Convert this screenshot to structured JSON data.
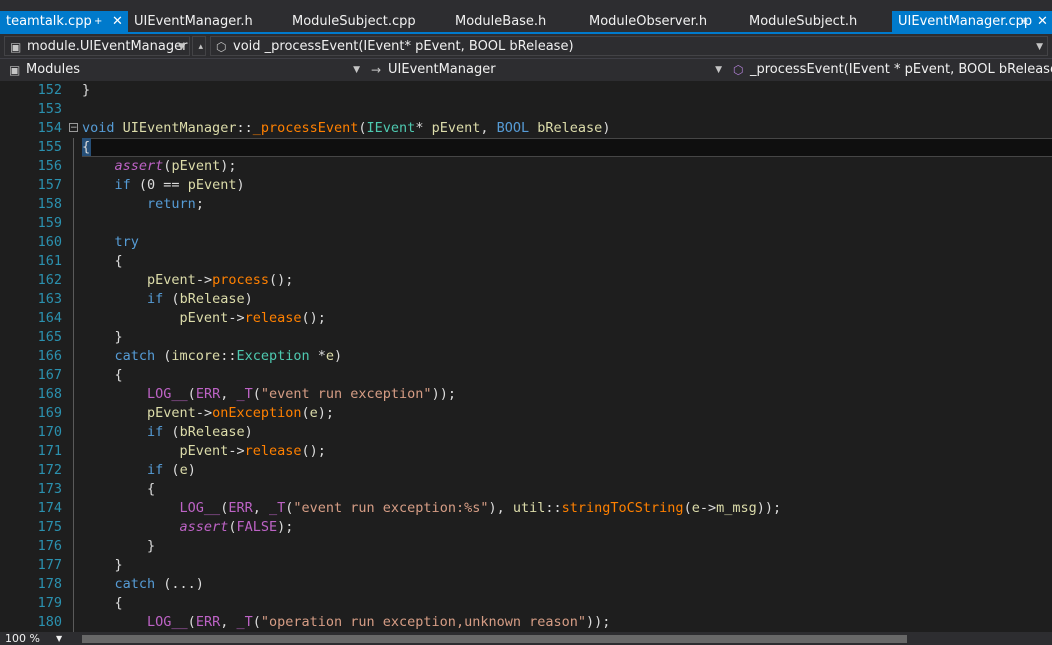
{
  "tabs": [
    {
      "label": "teamtalk.cpp",
      "active": true,
      "pinned": true,
      "closable": true
    },
    {
      "label": "UIEventManager.h"
    },
    {
      "label": "ModuleSubject.cpp"
    },
    {
      "label": "ModuleBase.h"
    },
    {
      "label": "ModuleObserver.h"
    },
    {
      "label": "ModuleSubject.h"
    },
    {
      "label": "UIEventManager.cpp",
      "active": true,
      "pinned": true,
      "closable": true
    }
  ],
  "nav1": {
    "scope": "module.UIEventManager",
    "member": "void _processEvent(IEvent* pEvent, BOOL bRelease)"
  },
  "nav2": {
    "project": "Modules",
    "class": "UIEventManager",
    "function": "_processEvent(IEvent * pEvent, BOOL bRelease)"
  },
  "code_lines": [
    {
      "n": "152",
      "text": "}"
    },
    {
      "n": "153",
      "text": ""
    },
    {
      "n": "154",
      "text": "void UIEventManager::_processEvent(IEvent* pEvent, BOOL bRelease)"
    },
    {
      "n": "155",
      "text": "{"
    },
    {
      "n": "156",
      "text": "    assert(pEvent);"
    },
    {
      "n": "157",
      "text": "    if (0 == pEvent)"
    },
    {
      "n": "158",
      "text": "        return;"
    },
    {
      "n": "159",
      "text": ""
    },
    {
      "n": "160",
      "text": "    try"
    },
    {
      "n": "161",
      "text": "    {"
    },
    {
      "n": "162",
      "text": "        pEvent->process();"
    },
    {
      "n": "163",
      "text": "        if (bRelease)"
    },
    {
      "n": "164",
      "text": "            pEvent->release();"
    },
    {
      "n": "165",
      "text": "    }"
    },
    {
      "n": "166",
      "text": "    catch (imcore::Exception *e)"
    },
    {
      "n": "167",
      "text": "    {"
    },
    {
      "n": "168",
      "text": "        LOG__(ERR, _T(\"event run exception\"));"
    },
    {
      "n": "169",
      "text": "        pEvent->onException(e);"
    },
    {
      "n": "170",
      "text": "        if (bRelease)"
    },
    {
      "n": "171",
      "text": "            pEvent->release();"
    },
    {
      "n": "172",
      "text": "        if (e)"
    },
    {
      "n": "173",
      "text": "        {"
    },
    {
      "n": "174",
      "text": "            LOG__(ERR, _T(\"event run exception:%s\"), util::stringToCString(e->m_msg));"
    },
    {
      "n": "175",
      "text": "            assert(FALSE);"
    },
    {
      "n": "176",
      "text": "        }"
    },
    {
      "n": "177",
      "text": "    }"
    },
    {
      "n": "178",
      "text": "    catch (...)"
    },
    {
      "n": "179",
      "text": "    {"
    },
    {
      "n": "180",
      "text": "        LOG__(ERR, _T(\"operation run exception,unknown reason\"));"
    }
  ],
  "status": {
    "zoom": "100 %"
  },
  "colors": {
    "accent": "#007acc",
    "line_number": "#2b91af",
    "keyword": "#569cd6",
    "function": "#ff8000",
    "macro": "#bd63c5",
    "string": "#d69d85",
    "background": "#1e1e1e"
  }
}
